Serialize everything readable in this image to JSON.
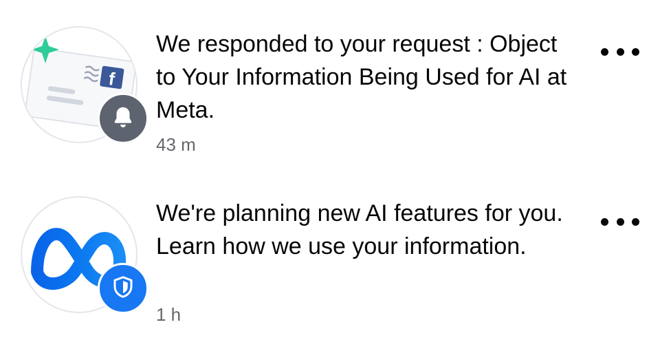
{
  "notifications": [
    {
      "text": "We responded to your request : Object to Your Information Being Used for AI at Meta.",
      "time": "43 m",
      "avatar_icon": "envelope-facebook-icon",
      "badge_icon": "bell-icon",
      "badge_color": "#5d6470"
    },
    {
      "text": "We're planning new AI features for you. Learn how we use your information.",
      "time": "1 h",
      "avatar_icon": "meta-logo-icon",
      "badge_icon": "shield-icon",
      "badge_color": "#1877f2"
    }
  ],
  "colors": {
    "primary_text": "#050505",
    "secondary_text": "#65676b",
    "meta_blue": "#1877f2",
    "sparkle_green": "#2ecc9a"
  }
}
